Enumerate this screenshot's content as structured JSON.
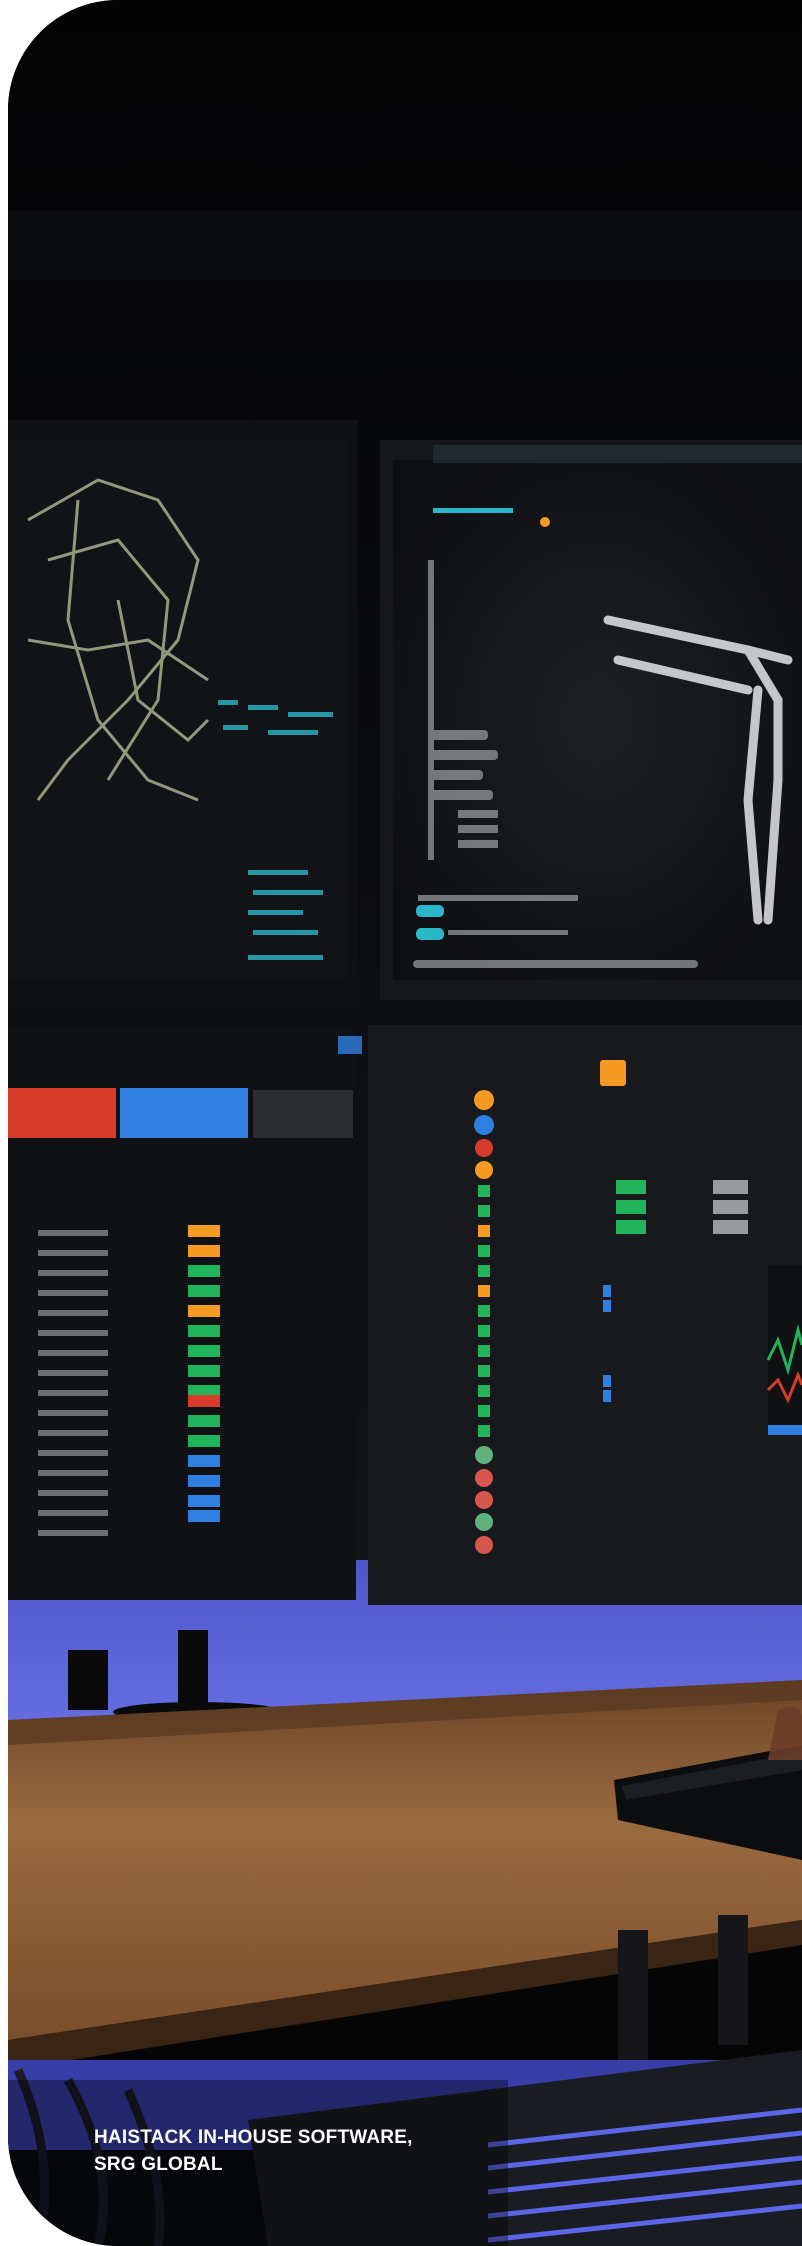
{
  "caption": {
    "line1": "HAISTACK IN-HOUSE SOFTWARE,",
    "line2": "SRG GLOBAL"
  },
  "colors": {
    "background": "#050506",
    "backlight": "#5b63d8",
    "desk": "#8a5a34",
    "screen_accent": "#2ab7c9",
    "status_orange": "#f59a23",
    "status_green": "#22b45a",
    "status_blue": "#2f7fe0",
    "status_red": "#d93b2b"
  }
}
